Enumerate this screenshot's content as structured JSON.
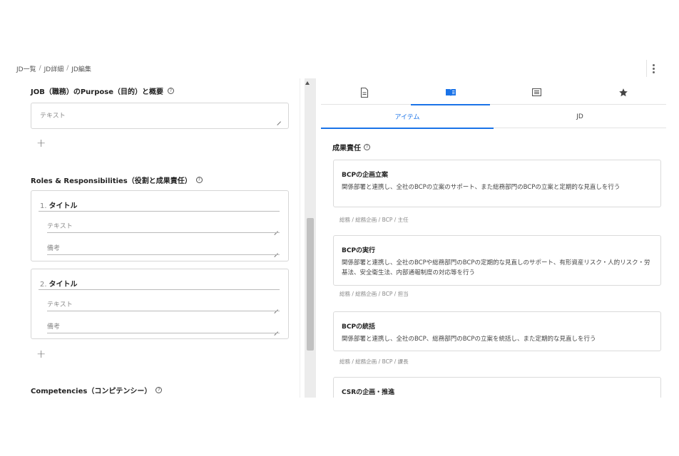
{
  "breadcrumb": {
    "items": [
      "JD一覧",
      "JD詳細",
      "JD編集"
    ],
    "separator": "/"
  },
  "left": {
    "purpose": {
      "title": "JOB（職務）のPurpose（目的）と概要",
      "placeholder": "テキスト"
    },
    "roles": {
      "title": "Roles & Responsibilities（役割と成果責任）",
      "cards": [
        {
          "num": "1.",
          "title": "タイトル",
          "text_placeholder": "テキスト",
          "note_placeholder": "備考"
        },
        {
          "num": "2.",
          "title": "タイトル",
          "text_placeholder": "テキスト",
          "note_placeholder": "備考"
        }
      ]
    },
    "competencies": {
      "title": "Competencies（コンピテンシー）"
    },
    "plus_label": "+",
    "help_mark": "?"
  },
  "right": {
    "icon_tabs": [
      "document-icon",
      "book-icon",
      "list-icon",
      "star-icon"
    ],
    "sub_tabs": [
      "アイテム",
      "JD"
    ],
    "section_title": "成果責任",
    "items": [
      {
        "title": "BCPの企画立案",
        "desc": "関係部署と連携し、全社のBCPの立案のサポート、また総務部門のBCPの立案と定期的な見直しを行う",
        "meta": "総務 / 総務企画 / BCP / 主任"
      },
      {
        "title": "BCPの実行",
        "desc": "関係部署と連携し、全社のBCPや総務部門のBCPの定期的な見直しのサポート、有形資産リスク・人的リスク・労基法、安全衛生法、内部通報制度の対応等を行う",
        "meta": "総務 / 総務企画 / BCP / 担当"
      },
      {
        "title": "BCPの統括",
        "desc": "関係部署と連携し、全社のBCP、総務部門のBCPの立案を統括し、また定期的な見直しを行う",
        "meta": "総務 / 総務企画 / BCP / 課長"
      },
      {
        "title": "CSRの企画・推進",
        "desc": "",
        "meta": ""
      }
    ],
    "accent_color": "#1a73e8"
  }
}
